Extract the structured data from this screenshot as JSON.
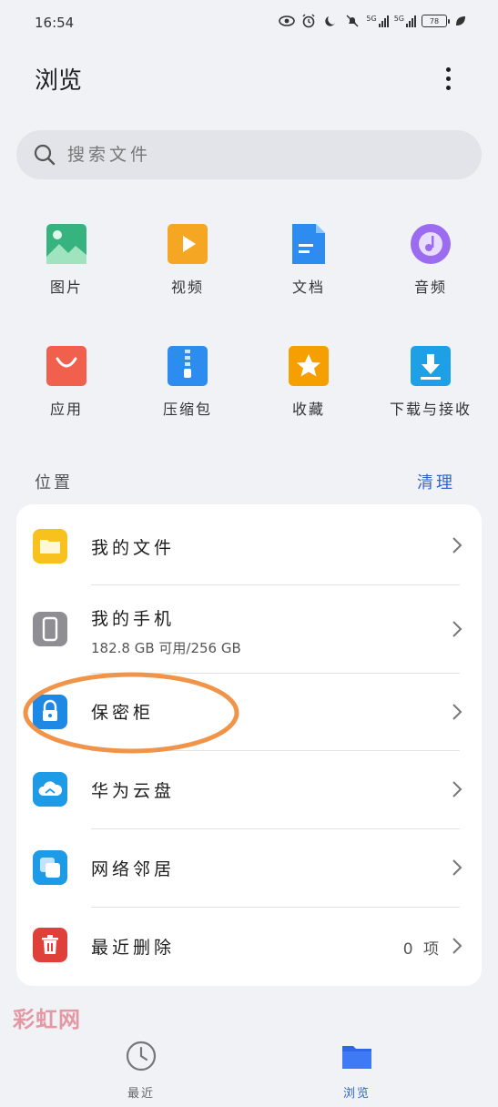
{
  "status_bar": {
    "time": "16:54",
    "signal_1_label": "5G",
    "signal_2_label": "5G",
    "battery": "78"
  },
  "header": {
    "title": "浏览"
  },
  "search": {
    "placeholder": "搜索文件"
  },
  "categories": [
    {
      "label": "图片",
      "icon": "image-icon",
      "color": "#36b37e"
    },
    {
      "label": "视频",
      "icon": "video-icon",
      "color": "#f5a623"
    },
    {
      "label": "文档",
      "icon": "document-icon",
      "color": "#2d8cf0"
    },
    {
      "label": "音频",
      "icon": "audio-icon",
      "color": "#9b6cf0"
    },
    {
      "label": "应用",
      "icon": "app-bag-icon",
      "color": "#f0604d"
    },
    {
      "label": "压缩包",
      "icon": "zip-icon",
      "color": "#2d8cf0"
    },
    {
      "label": "收藏",
      "icon": "star-icon",
      "color": "#f5a000"
    },
    {
      "label": "下载与接收",
      "icon": "download-icon",
      "color": "#1ea0e6"
    }
  ],
  "locations": {
    "title": "位置",
    "action_label": "清理",
    "items": [
      {
        "label": "我的文件",
        "icon": "folder-icon",
        "color": "#f7c21e"
      },
      {
        "label": "我的手机",
        "sub": "182.8 GB 可用/256 GB",
        "icon": "phone-icon",
        "color": "#8e8e93"
      },
      {
        "label": "保密柜",
        "icon": "lock-icon",
        "color": "#1e88e5"
      },
      {
        "label": "华为云盘",
        "icon": "cloud-icon",
        "color": "#1e9be6"
      },
      {
        "label": "网络邻居",
        "icon": "network-icon",
        "color": "#1e9be6"
      },
      {
        "label": "最近删除",
        "count": "0 项",
        "icon": "trash-icon",
        "color": "#e0403a"
      }
    ]
  },
  "bottom_nav": [
    {
      "label": "最近",
      "icon": "clock-icon",
      "active": false
    },
    {
      "label": "浏览",
      "icon": "folder-icon",
      "active": true
    }
  ],
  "watermark": {
    "text": "彩虹网"
  },
  "colors": {
    "accent": "#2f66c8",
    "annotation": "#f0944a"
  }
}
